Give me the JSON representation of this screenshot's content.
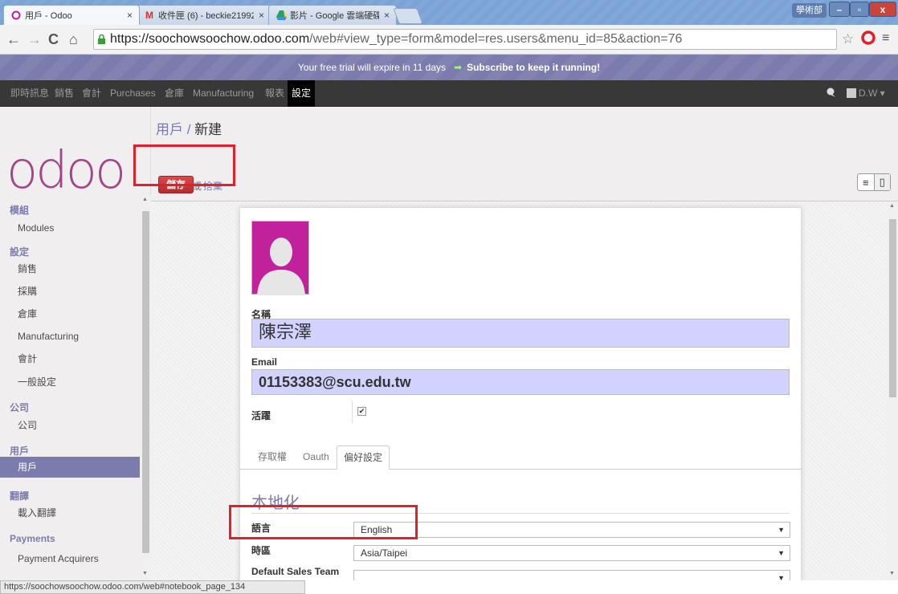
{
  "browser": {
    "tabs": [
      {
        "label": "用戶 - Odoo",
        "icon": "odoo-circle-icon"
      },
      {
        "label": "收件匣 (6) - beckie21992",
        "icon": "gmail-icon"
      },
      {
        "label": "影片 - Google 雲端硬碟",
        "icon": "google-drive-icon"
      }
    ],
    "user_badge": "學術部",
    "url_host": "https://soochowsoochow.odoo.com",
    "url_path": "/web#view_type=form&model=res.users&menu_id=85&action=76",
    "status_url": "https://soochowsoochow.odoo.com/web#notebook_page_134"
  },
  "trial": {
    "text": "Your free trial will expire in 11 days",
    "subscribe": "Subscribe to keep it running!"
  },
  "topmenu": {
    "items": [
      "即時訊息",
      "銷售",
      "會計",
      "Purchases",
      "倉庫",
      "Manufacturing",
      "報表",
      "設定"
    ],
    "active_index": 7,
    "user": "D.W"
  },
  "sidebar": {
    "logo": "odoo",
    "sections": [
      {
        "title": "模組",
        "items": [
          "Modules"
        ]
      },
      {
        "title": "設定",
        "items": [
          "銷售",
          "採購",
          "倉庫",
          "Manufacturing",
          "會計",
          "一般設定"
        ]
      },
      {
        "title": "公司",
        "items": [
          "公司"
        ]
      },
      {
        "title": "用戶",
        "items": [
          "用戶"
        ]
      },
      {
        "title": "翻譯",
        "items": [
          "載入翻譯"
        ]
      },
      {
        "title": "Payments",
        "items": [
          "Payment Acquirers"
        ]
      }
    ],
    "selected": "用戶"
  },
  "header": {
    "breadcrumb_parent": "用戶",
    "breadcrumb_sep": " / ",
    "breadcrumb_current": "新建",
    "save": "儲存",
    "or": "或",
    "discard": "捨棄"
  },
  "form": {
    "name_label": "名稱",
    "name_value": "陳宗澤",
    "email_label": "Email",
    "email_value": "01153383@scu.edu.tw",
    "active_label": "活躍",
    "active_checked": true,
    "tabs": [
      "存取權",
      "Oauth",
      "偏好設定"
    ],
    "active_tab": 2,
    "section_title": "本地化",
    "language_label": "語言",
    "language_value": "English",
    "timezone_label": "時區",
    "timezone_value": "Asia/Taipei",
    "sales_team_label": "Default Sales Team",
    "sales_team_value": ""
  },
  "colors": {
    "accent": "#7c7bad",
    "save": "#b42b2b",
    "highlight": "#e0202a",
    "field_bg": "#d2d2ff"
  }
}
